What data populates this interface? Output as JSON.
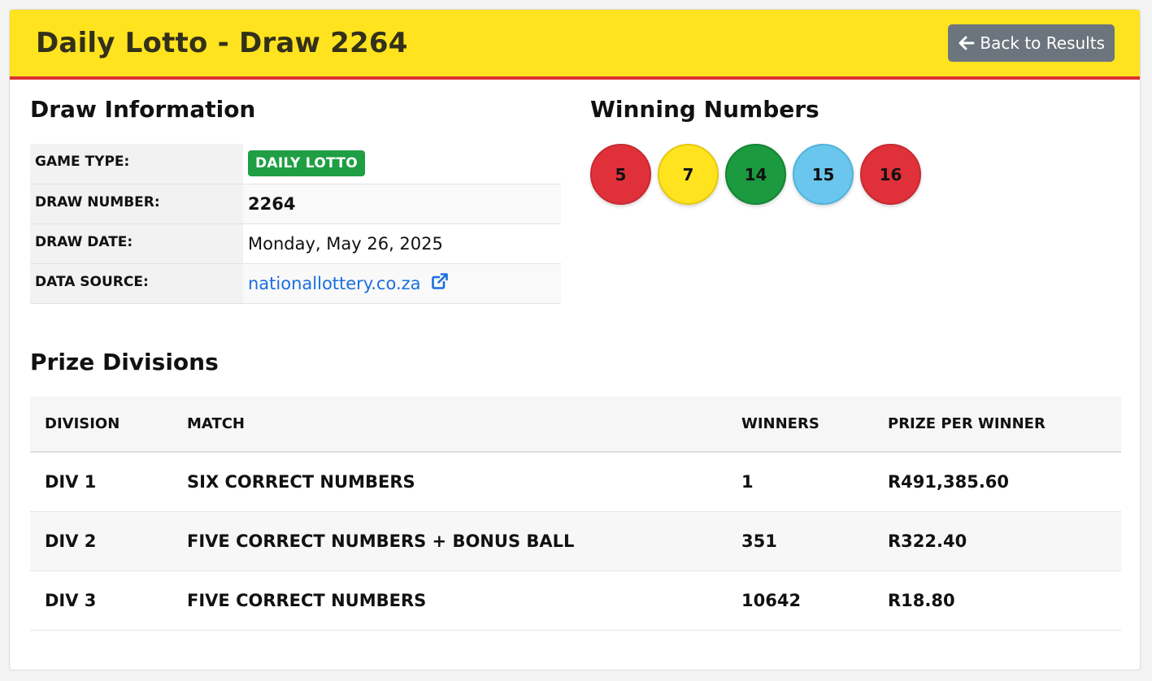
{
  "header": {
    "title": "Daily Lotto - Draw 2264",
    "back_label": "Back to Results"
  },
  "draw_info": {
    "title": "Draw Information",
    "rows": [
      {
        "label": "GAME TYPE:",
        "value": "DAILY LOTTO"
      },
      {
        "label": "DRAW NUMBER:",
        "value": "2264"
      },
      {
        "label": "DRAW DATE:",
        "value": "Monday, May 26, 2025"
      },
      {
        "label": "DATA SOURCE:",
        "value": "nationallottery.co.za"
      }
    ]
  },
  "winning": {
    "title": "Winning Numbers",
    "balls": [
      {
        "number": "5",
        "color": "#e0313a",
        "border": "#c72a31"
      },
      {
        "number": "7",
        "color": "#ffe31f",
        "border": "#e6c90c"
      },
      {
        "number": "14",
        "color": "#1b9a3f",
        "border": "#158334"
      },
      {
        "number": "15",
        "color": "#6ac6ec",
        "border": "#4fb3dd"
      },
      {
        "number": "16",
        "color": "#e0313a",
        "border": "#c72a31"
      }
    ]
  },
  "prizes": {
    "title": "Prize Divisions",
    "headers": [
      "DIVISION",
      "MATCH",
      "WINNERS",
      "PRIZE PER WINNER"
    ],
    "rows": [
      {
        "division": "DIV 1",
        "match": "SIX CORRECT NUMBERS",
        "winners": "1",
        "prize": "R491,385.60"
      },
      {
        "division": "DIV 2",
        "match": "FIVE CORRECT NUMBERS + BONUS BALL",
        "winners": "351",
        "prize": "R322.40"
      },
      {
        "division": "DIV 3",
        "match": "FIVE CORRECT NUMBERS",
        "winners": "10642",
        "prize": "R18.80"
      }
    ]
  },
  "colors": {
    "header_bg": "#ffe31f",
    "header_accent": "#dc3232",
    "badge": "#1f9e43",
    "link": "#1a6fe0",
    "button": "#6c757d"
  },
  "icons": {
    "back": "arrow-left-icon",
    "external": "external-link-icon"
  }
}
